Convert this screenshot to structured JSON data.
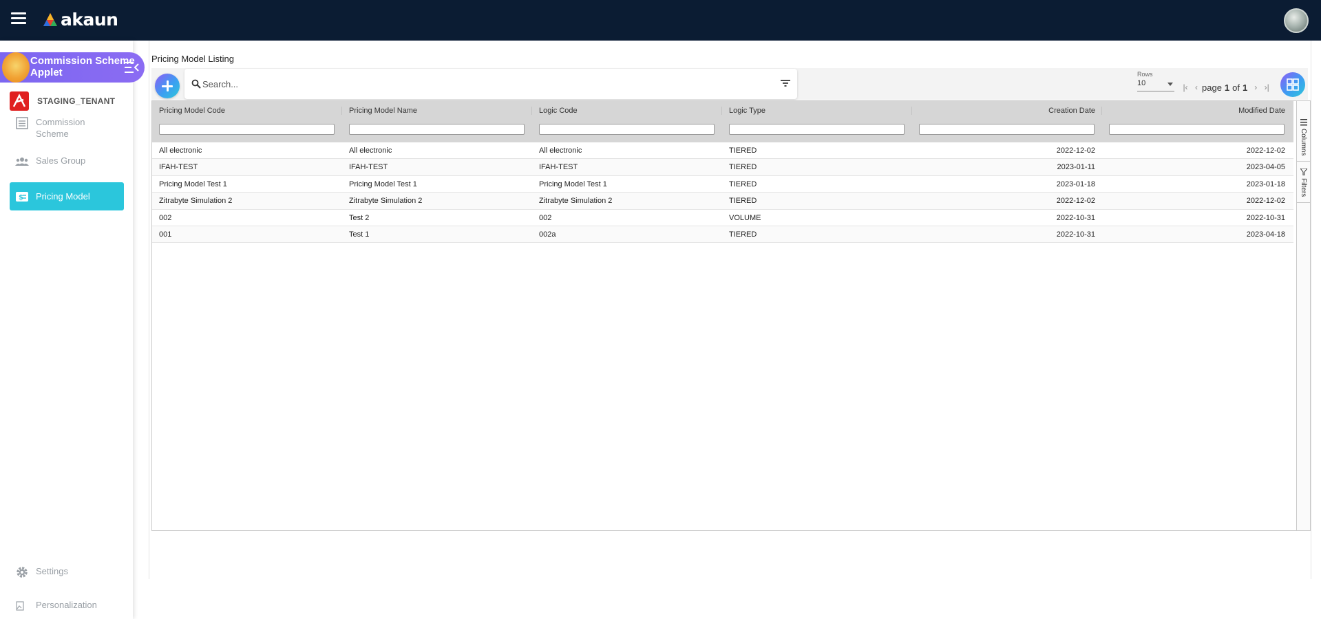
{
  "app": {
    "logo_text": "akaun",
    "menu_icon": "hamburger-menu-icon",
    "avatar_icon": "user-avatar"
  },
  "sidebar": {
    "applet_title": "Commission Scheme Applet",
    "tenant_name": "STAGING_TENANT",
    "items": [
      {
        "label": "Commission Scheme",
        "icon": "document-list-icon",
        "active": false
      },
      {
        "label": "Sales Group",
        "icon": "group-icon",
        "active": false
      },
      {
        "label": "Pricing Model",
        "icon": "pricing-tag-icon",
        "active": true
      }
    ],
    "footer_items": [
      {
        "label": "Settings",
        "icon": "gear-icon"
      },
      {
        "label": "Personalization",
        "icon": "broken-image-icon"
      }
    ],
    "accent_color": "#2bc6dc"
  },
  "main": {
    "title": "Pricing Model Listing",
    "search_placeholder": "Search...",
    "rows_label": "Rows",
    "rows_value": "10",
    "pager": {
      "prefix": "page",
      "current": "1",
      "of": "of",
      "total": "1"
    },
    "side_tabs": [
      "Columns",
      "Filters"
    ]
  },
  "table": {
    "columns": [
      "Pricing Model Code",
      "Pricing Model Name",
      "Logic Code",
      "Logic Type",
      "Creation Date",
      "Modified Date"
    ],
    "rows": [
      [
        "All electronic",
        "All electronic",
        "All electronic",
        "TIERED",
        "2022-12-02",
        "2022-12-02"
      ],
      [
        "IFAH-TEST",
        "IFAH-TEST",
        "IFAH-TEST",
        "TIERED",
        "2023-01-11",
        "2023-04-05"
      ],
      [
        "Pricing Model Test 1",
        "Pricing Model Test 1",
        "Pricing Model Test 1",
        "TIERED",
        "2023-01-18",
        "2023-01-18"
      ],
      [
        "Zitrabyte Simulation 2",
        "Zitrabyte Simulation 2",
        "Zitrabyte Simulation 2",
        "TIERED",
        "2022-12-02",
        "2022-12-02"
      ],
      [
        "002",
        "Test 2",
        "002",
        "VOLUME",
        "2022-10-31",
        "2022-10-31"
      ],
      [
        "001",
        "Test 1",
        "002a",
        "TIERED",
        "2022-10-31",
        "2023-04-18"
      ]
    ]
  },
  "colors": {
    "topbar": "#0b1c33",
    "applet_gradient_start": "#7c66f0",
    "header_row": "#d6d6d6"
  }
}
